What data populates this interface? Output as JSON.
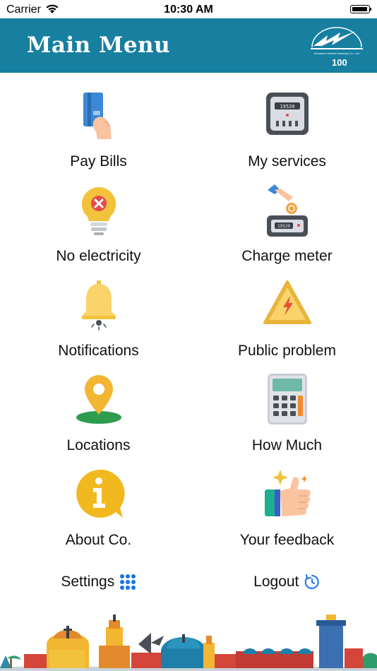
{
  "status_bar": {
    "carrier": "Carrier",
    "time": "10:30 AM"
  },
  "header": {
    "title": "Main Menu",
    "logo_badge": "100",
    "logo_name": "Jerusalem District Electricity Co. Ltd."
  },
  "menu": [
    {
      "label": "Pay Bills",
      "icon": "credit-card-hand-icon"
    },
    {
      "label": "My services",
      "icon": "electric-meter-icon"
    },
    {
      "label": "No electricity",
      "icon": "bulb-off-icon"
    },
    {
      "label": "Charge meter",
      "icon": "coin-meter-icon"
    },
    {
      "label": "Notifications",
      "icon": "bell-icon"
    },
    {
      "label": "Public problem",
      "icon": "warning-icon"
    },
    {
      "label": "Locations",
      "icon": "location-pin-icon"
    },
    {
      "label": "How Much",
      "icon": "calculator-icon"
    },
    {
      "label": "About Co.",
      "icon": "info-icon"
    },
    {
      "label": "Your feedback",
      "icon": "thumbs-up-icon"
    }
  ],
  "footer_actions": {
    "settings": "Settings",
    "logout": "Logout"
  },
  "colors": {
    "header": "#177fa0",
    "accent_blue": "#1a73e8"
  }
}
